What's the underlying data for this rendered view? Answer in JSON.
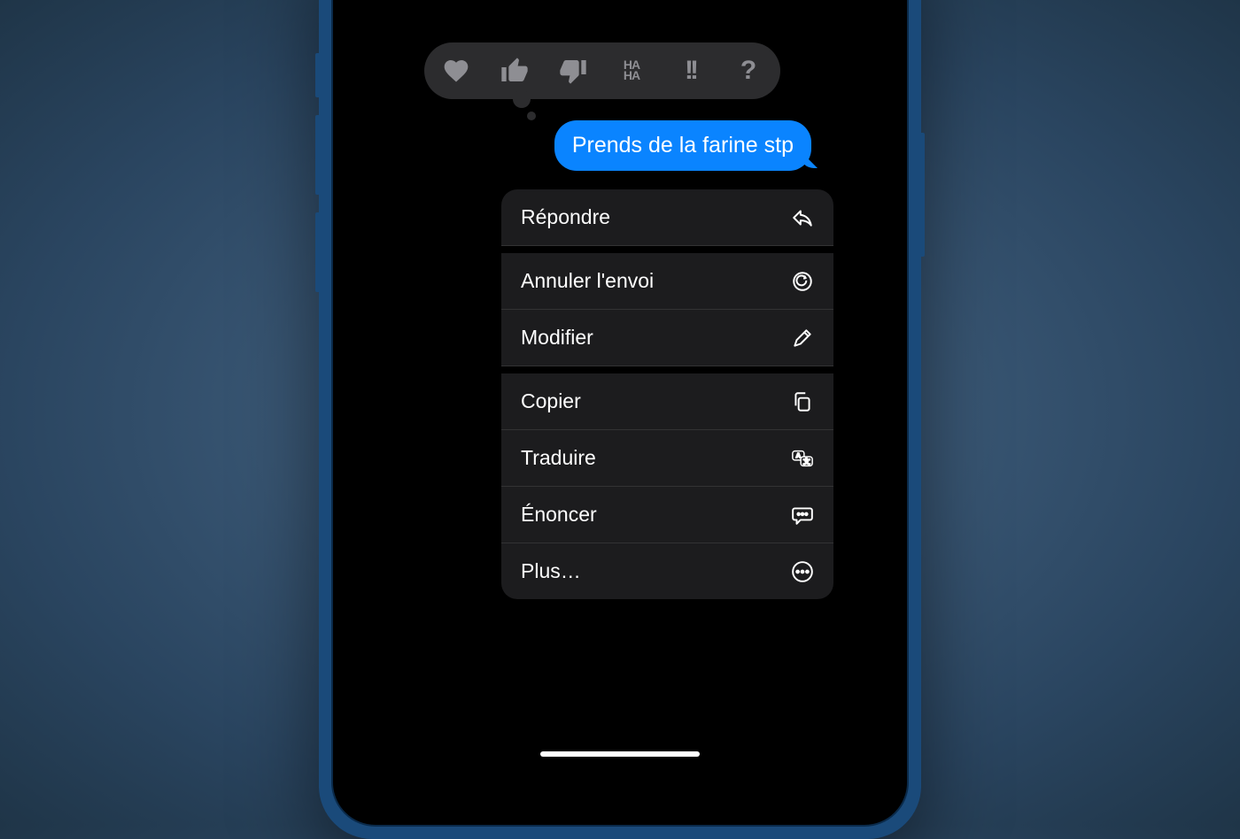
{
  "message": {
    "text": "Prends de la farine stp"
  },
  "tapback": {
    "haha": "HA\nHA",
    "emphasis": "!!",
    "question": "?"
  },
  "menu": {
    "reply": "Répondre",
    "undo_send": "Annuler l'envoi",
    "edit": "Modifier",
    "copy": "Copier",
    "translate": "Traduire",
    "speak": "Énoncer",
    "more": "Plus…"
  }
}
